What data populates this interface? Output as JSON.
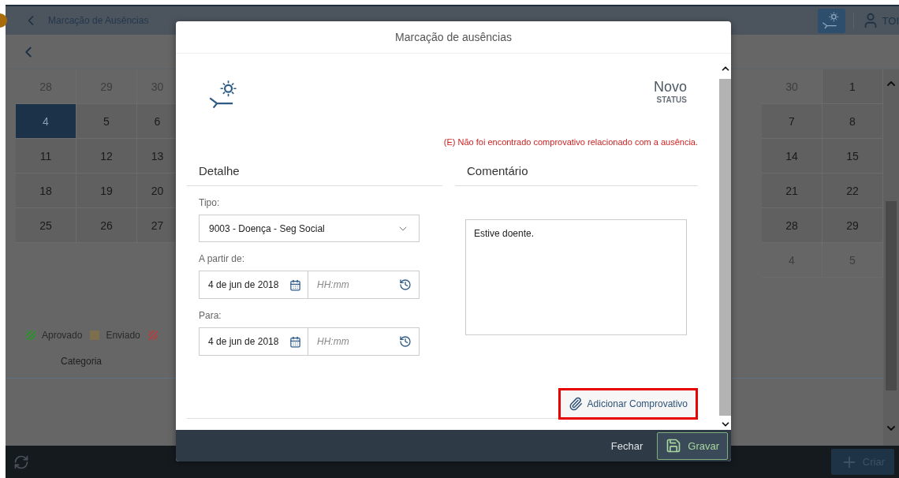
{
  "header": {
    "title": "Marcação de Ausências",
    "user": "TOI"
  },
  "calendar": {
    "weeks": [
      {
        "left": [
          {
            "day": "28",
            "muted": true,
            "selected": false
          },
          {
            "day": "29",
            "muted": true,
            "selected": false
          },
          {
            "day": "30",
            "muted": true,
            "selected": false
          }
        ],
        "right": [
          {
            "day": "30",
            "muted": true,
            "selected": false
          },
          {
            "day": "1",
            "muted": false,
            "selected": false
          }
        ]
      },
      {
        "left": [
          {
            "day": "4",
            "muted": false,
            "selected": true
          },
          {
            "day": "5",
            "muted": false,
            "selected": false
          },
          {
            "day": "6",
            "muted": false,
            "selected": false
          }
        ],
        "right": [
          {
            "day": "7",
            "muted": false,
            "selected": false
          },
          {
            "day": "8",
            "muted": false,
            "selected": false
          }
        ]
      },
      {
        "left": [
          {
            "day": "11",
            "muted": false,
            "selected": false
          },
          {
            "day": "12",
            "muted": false,
            "selected": false
          },
          {
            "day": "13",
            "muted": false,
            "selected": false
          }
        ],
        "right": [
          {
            "day": "14",
            "muted": false,
            "selected": false
          },
          {
            "day": "15",
            "muted": false,
            "selected": false
          }
        ]
      },
      {
        "left": [
          {
            "day": "18",
            "muted": false,
            "selected": false
          },
          {
            "day": "19",
            "muted": false,
            "selected": false
          },
          {
            "day": "20",
            "muted": false,
            "selected": false
          }
        ],
        "right": [
          {
            "day": "21",
            "muted": false,
            "selected": false
          },
          {
            "day": "22",
            "muted": false,
            "selected": false
          }
        ]
      },
      {
        "left": [
          {
            "day": "25",
            "muted": false,
            "selected": false
          },
          {
            "day": "26",
            "muted": false,
            "selected": false
          },
          {
            "day": "27",
            "muted": false,
            "selected": false
          }
        ],
        "right": [
          {
            "day": "28",
            "muted": false,
            "selected": false
          },
          {
            "day": "29",
            "muted": false,
            "selected": false
          }
        ]
      },
      {
        "right": [
          {
            "day": "4",
            "muted": true,
            "selected": false
          },
          {
            "day": "5",
            "muted": true,
            "selected": false
          }
        ]
      }
    ]
  },
  "legend": [
    {
      "label": "Aprovado",
      "color": "#2f8f2f",
      "kind": "hatched"
    },
    {
      "label": "Enviado",
      "color": "#7d6f4e",
      "kind": "solid"
    },
    {
      "color": "#a84444",
      "kind": "hatched"
    }
  ],
  "table": {
    "columns": [
      "Categoria"
    ]
  },
  "bottom_bar": {
    "create_button": "Criar"
  },
  "dialog": {
    "title": "Marcação de ausências",
    "status": {
      "value": "Novo",
      "label": "STATUS"
    },
    "error": "(E) Não foi encontrado comprovativo relacionado com a ausência.",
    "detail": {
      "heading": "Detalhe",
      "type_label": "Tipo:",
      "type_value": "9003 - Doença - Seg Social",
      "from_label": "A partir de:",
      "from_date": "4 de jun de 2018",
      "from_time_placeholder": "HH:mm",
      "to_label": "Para:",
      "to_date": "4 de jun de 2018",
      "to_time_placeholder": "HH:mm"
    },
    "comment": {
      "heading": "Comentário",
      "value": "Estive doente."
    },
    "attach_button": {
      "label": "Adicionar Comprovativo",
      "highlighted": true
    },
    "buttons": {
      "close": "Fechar",
      "save": "Gravar"
    }
  }
}
